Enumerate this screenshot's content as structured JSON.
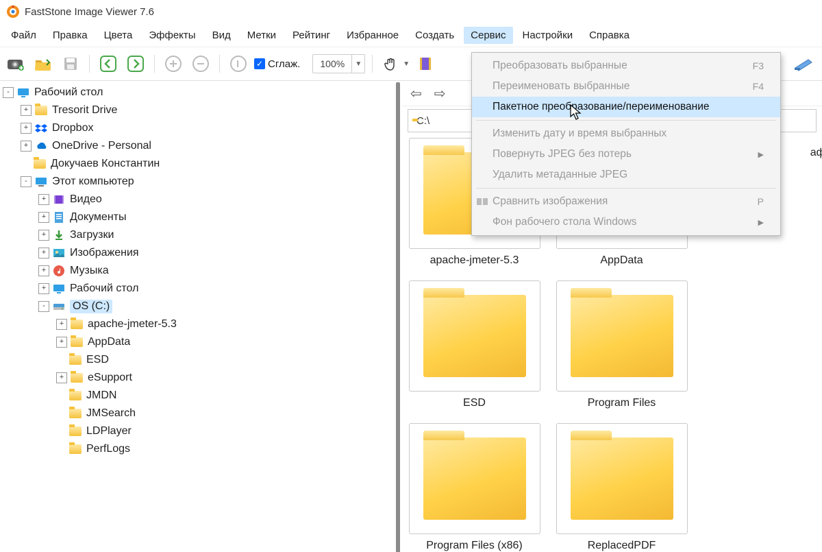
{
  "title": "FastStone Image Viewer 7.6",
  "menus": [
    "Файл",
    "Правка",
    "Цвета",
    "Эффекты",
    "Вид",
    "Метки",
    "Рейтинг",
    "Избранное",
    "Создать",
    "Сервис",
    "Настройки",
    "Справка"
  ],
  "menu_active_index": 9,
  "toolbar": {
    "smooth_label": "Сглаж.",
    "zoom_value": "100%"
  },
  "right_clip_label": "афика",
  "tree": [
    {
      "depth": 0,
      "exp": "-",
      "icon": "desktop",
      "label": "Рабочий стол"
    },
    {
      "depth": 1,
      "exp": "+",
      "icon": "folder",
      "label": "Tresorit Drive"
    },
    {
      "depth": 1,
      "exp": "+",
      "icon": "dropbox",
      "label": "Dropbox"
    },
    {
      "depth": 1,
      "exp": "+",
      "icon": "onedrive",
      "label": "OneDrive - Personal"
    },
    {
      "depth": 1,
      "exp": " ",
      "icon": "folder",
      "label": "Докучаев Константин"
    },
    {
      "depth": 1,
      "exp": "-",
      "icon": "pc",
      "label": "Этот компьютер"
    },
    {
      "depth": 2,
      "exp": "+",
      "icon": "video",
      "label": "Видео"
    },
    {
      "depth": 2,
      "exp": "+",
      "icon": "docs",
      "label": "Документы"
    },
    {
      "depth": 2,
      "exp": "+",
      "icon": "down",
      "label": "Загрузки"
    },
    {
      "depth": 2,
      "exp": "+",
      "icon": "img",
      "label": "Изображения"
    },
    {
      "depth": 2,
      "exp": "+",
      "icon": "music",
      "label": "Музыка"
    },
    {
      "depth": 2,
      "exp": "+",
      "icon": "desktop2",
      "label": "Рабочий стол"
    },
    {
      "depth": 2,
      "exp": "-",
      "icon": "drive",
      "label": "OS (C:)",
      "selected": true
    },
    {
      "depth": 3,
      "exp": "+",
      "icon": "folder",
      "label": "apache-jmeter-5.3"
    },
    {
      "depth": 3,
      "exp": "+",
      "icon": "folder",
      "label": "AppData"
    },
    {
      "depth": 3,
      "exp": " ",
      "icon": "folder",
      "label": "ESD"
    },
    {
      "depth": 3,
      "exp": "+",
      "icon": "folder",
      "label": "eSupport"
    },
    {
      "depth": 3,
      "exp": " ",
      "icon": "folder",
      "label": "JMDN"
    },
    {
      "depth": 3,
      "exp": " ",
      "icon": "folder",
      "label": "JMSearch"
    },
    {
      "depth": 3,
      "exp": " ",
      "icon": "folder",
      "label": "LDPlayer"
    },
    {
      "depth": 3,
      "exp": " ",
      "icon": "folder",
      "label": "PerfLogs"
    }
  ],
  "path": "C:\\",
  "thumbs": [
    "apache-jmeter-5.3",
    "AppData",
    "ESD",
    "Program Files",
    "Program Files (x86)",
    "ReplacedPDF"
  ],
  "dropdown": [
    {
      "type": "item",
      "label": "Преобразовать выбранные",
      "shortcut": "F3",
      "enabled": false
    },
    {
      "type": "item",
      "label": "Переименовать выбранные",
      "shortcut": "F4",
      "enabled": false
    },
    {
      "type": "item",
      "label": "Пакетное преобразование/переименование",
      "enabled": true,
      "highlight": true
    },
    {
      "type": "sep"
    },
    {
      "type": "item",
      "label": "Изменить дату и время выбранных",
      "enabled": false
    },
    {
      "type": "item",
      "label": "Повернуть JPEG без потерь",
      "enabled": false,
      "submenu": true
    },
    {
      "type": "item",
      "label": "Удалить метаданные JPEG",
      "enabled": false
    },
    {
      "type": "sep"
    },
    {
      "type": "item",
      "label": "Сравнить изображения",
      "shortcut": "P",
      "enabled": false,
      "icon": true
    },
    {
      "type": "item",
      "label": "Фон рабочего стола Windows",
      "enabled": false,
      "submenu": true
    }
  ]
}
